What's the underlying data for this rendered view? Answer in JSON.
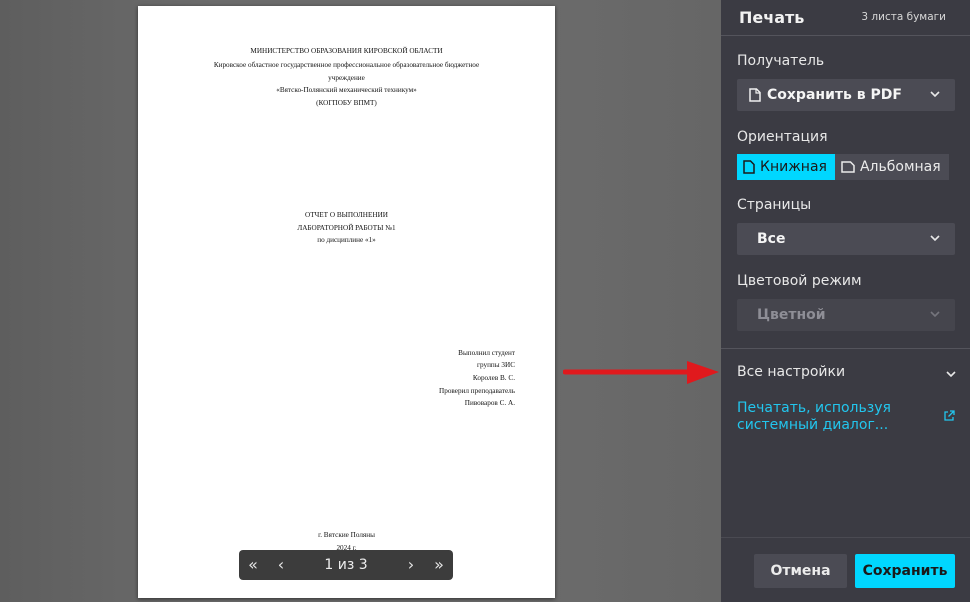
{
  "panel": {
    "title": "Печать",
    "sheet_count": "3 листа бумаги",
    "recipient": {
      "label": "Получатель",
      "value": "Сохранить в PDF"
    },
    "orientation": {
      "label": "Ориентация",
      "portrait": "Книжная",
      "landscape": "Альбомная",
      "selected": "Книжная"
    },
    "pages": {
      "label": "Страницы",
      "value": "Все"
    },
    "color_mode": {
      "label": "Цветовой режим",
      "value": "Цветной"
    },
    "all_settings": "Все настройки",
    "system_dialog_link": "Печатать, используя системный диалог...",
    "cancel_label": "Отмена",
    "save_label": "Сохранить",
    "accent_color": "#00d7ff"
  },
  "pager": {
    "first_icon": "«",
    "prev_icon": "‹",
    "page_indicator": "1 из 3",
    "next_icon": "›",
    "last_icon": "»"
  },
  "document": {
    "header": [
      "МИНИСТЕРСТВО ОБРАЗОВАНИЯ КИРОВСКОЙ ОБЛАСТИ",
      "Кировское областное государственное профессиональное образовательное бюджетное",
      "учреждение",
      "«Вятско-Полянский механический техникум»",
      "(КОГПОБУ ВПМТ)"
    ],
    "title": [
      "ОТЧЕТ О ВЫПОЛНЕНИИ",
      "ЛАБОРАТОРНОЙ РАБОТЫ №1",
      "по дисциплине «1»"
    ],
    "signature": [
      "Выполнил студент",
      "группы 3ИС",
      "Королев В. С.",
      "Проверил преподаватель",
      "Пивоваров С. А."
    ],
    "footer": [
      "г. Вятские Поляны",
      "2024 г."
    ]
  }
}
